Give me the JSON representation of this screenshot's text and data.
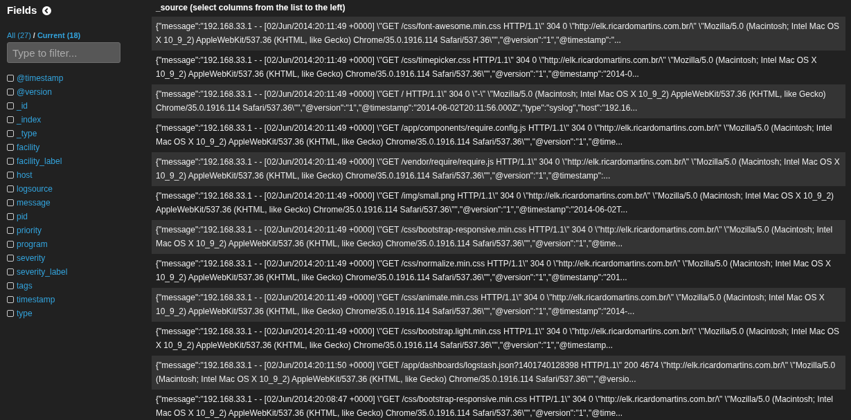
{
  "sidebar": {
    "title": "Fields",
    "views": [
      {
        "label": "All (27)",
        "selected": false
      },
      {
        "label": "Current (18)",
        "selected": true
      }
    ],
    "separator": "/",
    "filter": {
      "placeholder": "Type to filter..."
    },
    "fields": [
      {
        "label": "@timestamp",
        "checked": false
      },
      {
        "label": "@version",
        "checked": false
      },
      {
        "label": "_id",
        "checked": false
      },
      {
        "label": "_index",
        "checked": false
      },
      {
        "label": "_type",
        "checked": false
      },
      {
        "label": "facility",
        "checked": false
      },
      {
        "label": "facility_label",
        "checked": false
      },
      {
        "label": "host",
        "checked": false
      },
      {
        "label": "logsource",
        "checked": false
      },
      {
        "label": "message",
        "checked": false
      },
      {
        "label": "pid",
        "checked": false
      },
      {
        "label": "priority",
        "checked": false
      },
      {
        "label": "program",
        "checked": false
      },
      {
        "label": "severity",
        "checked": false
      },
      {
        "label": "severity_label",
        "checked": false
      },
      {
        "label": "tags",
        "checked": false
      },
      {
        "label": "timestamp",
        "checked": false
      },
      {
        "label": "type",
        "checked": false
      }
    ]
  },
  "table": {
    "column": "_source (select columns from the list to the left)",
    "rows": [
      "{\"message\":\"192.168.33.1 - - [02/Jun/2014:20:11:49 +0000] \\\"GET /css/font-awesome.min.css HTTP/1.1\\\" 304 0 \\\"http://elk.ricardomartins.com.br/\\\" \\\"Mozilla/5.0 (Macintosh; Intel Mac OS X 10_9_2) AppleWebKit/537.36 (KHTML, like Gecko) Chrome/35.0.1916.114 Safari/537.36\\\"\",\"@version\":\"1\",\"@timestamp\":\"...",
      "{\"message\":\"192.168.33.1 - - [02/Jun/2014:20:11:49 +0000] \\\"GET /css/timepicker.css HTTP/1.1\\\" 304 0 \\\"http://elk.ricardomartins.com.br/\\\" \\\"Mozilla/5.0 (Macintosh; Intel Mac OS X 10_9_2) AppleWebKit/537.36 (KHTML, like Gecko) Chrome/35.0.1916.114 Safari/537.36\\\"\",\"@version\":\"1\",\"@timestamp\":\"2014-0...",
      "{\"message\":\"192.168.33.1 - - [02/Jun/2014:20:11:49 +0000] \\\"GET / HTTP/1.1\\\" 304 0 \\\"-\\\" \\\"Mozilla/5.0 (Macintosh; Intel Mac OS X 10_9_2) AppleWebKit/537.36 (KHTML, like Gecko) Chrome/35.0.1916.114 Safari/537.36\\\"\",\"@version\":\"1\",\"@timestamp\":\"2014-06-02T20:11:56.000Z\",\"type\":\"syslog\",\"host\":\"192.16...",
      "{\"message\":\"192.168.33.1 - - [02/Jun/2014:20:11:49 +0000] \\\"GET /app/components/require.config.js HTTP/1.1\\\" 304 0 \\\"http://elk.ricardomartins.com.br/\\\" \\\"Mozilla/5.0 (Macintosh; Intel Mac OS X 10_9_2) AppleWebKit/537.36 (KHTML, like Gecko) Chrome/35.0.1916.114 Safari/537.36\\\"\",\"@version\":\"1\",\"@time...",
      "{\"message\":\"192.168.33.1 - - [02/Jun/2014:20:11:49 +0000] \\\"GET /vendor/require/require.js HTTP/1.1\\\" 304 0 \\\"http://elk.ricardomartins.com.br/\\\" \\\"Mozilla/5.0 (Macintosh; Intel Mac OS X 10_9_2) AppleWebKit/537.36 (KHTML, like Gecko) Chrome/35.0.1916.114 Safari/537.36\\\"\",\"@version\":\"1\",\"@timestamp\":...",
      "{\"message\":\"192.168.33.1 - - [02/Jun/2014:20:11:49 +0000] \\\"GET /img/small.png HTTP/1.1\\\" 304 0 \\\"http://elk.ricardomartins.com.br/\\\" \\\"Mozilla/5.0 (Macintosh; Intel Mac OS X 10_9_2) AppleWebKit/537.36 (KHTML, like Gecko) Chrome/35.0.1916.114 Safari/537.36\\\"\",\"@version\":\"1\",\"@timestamp\":\"2014-06-02T...",
      "{\"message\":\"192.168.33.1 - - [02/Jun/2014:20:11:49 +0000] \\\"GET /css/bootstrap-responsive.min.css HTTP/1.1\\\" 304 0 \\\"http://elk.ricardomartins.com.br/\\\" \\\"Mozilla/5.0 (Macintosh; Intel Mac OS X 10_9_2) AppleWebKit/537.36 (KHTML, like Gecko) Chrome/35.0.1916.114 Safari/537.36\\\"\",\"@version\":\"1\",\"@time...",
      "{\"message\":\"192.168.33.1 - - [02/Jun/2014:20:11:49 +0000] \\\"GET /css/normalize.min.css HTTP/1.1\\\" 304 0 \\\"http://elk.ricardomartins.com.br/\\\" \\\"Mozilla/5.0 (Macintosh; Intel Mac OS X 10_9_2) AppleWebKit/537.36 (KHTML, like Gecko) Chrome/35.0.1916.114 Safari/537.36\\\"\",\"@version\":\"1\",\"@timestamp\":\"201...",
      "{\"message\":\"192.168.33.1 - - [02/Jun/2014:20:11:49 +0000] \\\"GET /css/animate.min.css HTTP/1.1\\\" 304 0 \\\"http://elk.ricardomartins.com.br/\\\" \\\"Mozilla/5.0 (Macintosh; Intel Mac OS X 10_9_2) AppleWebKit/537.36 (KHTML, like Gecko) Chrome/35.0.1916.114 Safari/537.36\\\"\",\"@version\":\"1\",\"@timestamp\":\"2014-...",
      "{\"message\":\"192.168.33.1 - - [02/Jun/2014:20:11:49 +0000] \\\"GET /css/bootstrap.light.min.css HTTP/1.1\\\" 304 0 \\\"http://elk.ricardomartins.com.br/\\\" \\\"Mozilla/5.0 (Macintosh; Intel Mac OS X 10_9_2) AppleWebKit/537.36 (KHTML, like Gecko) Chrome/35.0.1916.114 Safari/537.36\\\"\",\"@version\":\"1\",\"@timestamp...",
      "{\"message\":\"192.168.33.1 - - [02/Jun/2014:20:11:50 +0000] \\\"GET /app/dashboards/logstash.json?1401740128398 HTTP/1.1\\\" 200 4674 \\\"http://elk.ricardomartins.com.br/\\\" \\\"Mozilla/5.0 (Macintosh; Intel Mac OS X 10_9_2) AppleWebKit/537.36 (KHTML, like Gecko) Chrome/35.0.1916.114 Safari/537.36\\\"\",\"@versio...",
      "{\"message\":\"192.168.33.1 - - [02/Jun/2014:20:08:47 +0000] \\\"GET /css/bootstrap-responsive.min.css HTTP/1.1\\\" 304 0 \\\"http://elk.ricardomartins.com.br/\\\" \\\"Mozilla/5.0 (Macintosh; Intel Mac OS X 10_9_2) AppleWebKit/537.36 (KHTML, like Gecko) Chrome/35.0.1916.114 Safari/537.36\\\"\",\"@version\":\"1\",\"@time..."
    ]
  }
}
